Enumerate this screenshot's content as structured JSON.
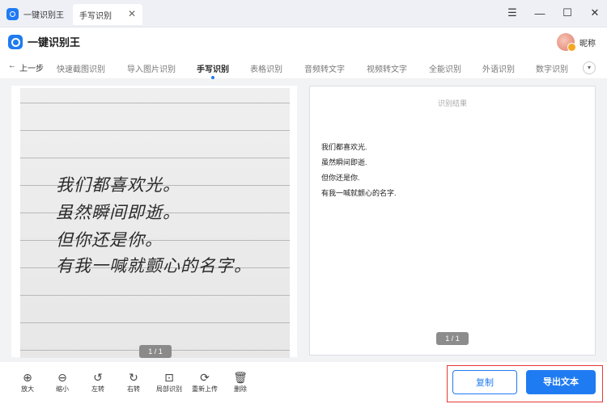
{
  "titlebar": {
    "app_name": "一键识别王",
    "doc_tab": "手写识别",
    "close": "✕",
    "controls": [
      "☰",
      "—",
      "☐",
      "✕"
    ]
  },
  "header": {
    "brand": "一键识别王",
    "username": "昵称"
  },
  "nav": {
    "back": "上一步",
    "back_icon": "←",
    "items": [
      "快速截图识别",
      "导入图片识别",
      "手写识别",
      "表格识别",
      "音频转文字",
      "视频转文字",
      "全能识别",
      "外语识别",
      "数字识别"
    ],
    "active_index": 2,
    "more_icon": "chevron-down-icon"
  },
  "left_panel": {
    "handwriting_lines": [
      "我们都喜欢光。",
      "虽然瞬间即逝。",
      "但你还是你。",
      "有我一喊就颤心的名字。"
    ],
    "pager": "1 / 1"
  },
  "right_panel": {
    "title": "识别结果",
    "lines": [
      "我们都喜欢光.",
      "虽然瞬间即逝.",
      "但你还是你.",
      "有我一喊就颤心的名字."
    ],
    "pager": "1 / 1"
  },
  "toolbar": {
    "tools": [
      {
        "label": "放大",
        "icon": "zoom-in-icon",
        "glyph": "⊕"
      },
      {
        "label": "缩小",
        "icon": "zoom-out-icon",
        "glyph": "⊖"
      },
      {
        "label": "左转",
        "icon": "rotate-left-icon",
        "glyph": "↺"
      },
      {
        "label": "右转",
        "icon": "rotate-right-icon",
        "glyph": "↻"
      },
      {
        "label": "局部识别",
        "icon": "partial-recognize-icon",
        "glyph": "⊡"
      },
      {
        "label": "重新上传",
        "icon": "reupload-icon",
        "glyph": "⟳"
      },
      {
        "label": "删除",
        "icon": "trash-icon",
        "glyph": "🗑"
      }
    ],
    "copy_label": "复制",
    "export_label": "导出文本"
  },
  "colors": {
    "accent": "#1f7bf2",
    "highlight_border": "#e53935"
  }
}
